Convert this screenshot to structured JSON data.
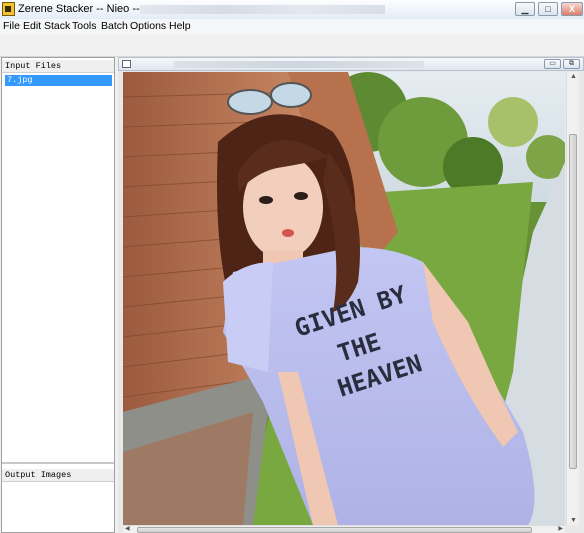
{
  "window": {
    "title": "Zerene Stacker -- Nieo --",
    "buttons": {
      "minimize": "▁",
      "maximize": "□",
      "close": "X"
    }
  },
  "menu": {
    "items": [
      "File",
      "Edit",
      "Stack",
      "Tools",
      "Batch",
      "Options",
      "Help"
    ]
  },
  "left_panel": {
    "input_header": "Input Files",
    "input_files": [
      "7.jpg"
    ],
    "output_header": "Output Images"
  },
  "image_window": {
    "buttons": {
      "minimize": "▭",
      "maximize": "⧉"
    },
    "shirt_text": [
      "GIVEN BY",
      "THE",
      "HEAVEN"
    ]
  },
  "colors": {
    "selection": "#3399ff",
    "shirt": "#b9bdee",
    "hair": "#5a2c1c",
    "wall": "#b06a4a",
    "grass": "#6f9d3e",
    "path": "#d8dfe4"
  },
  "icons": [
    "app-icon",
    "image-window-icon",
    "minimize-icon",
    "maximize-icon",
    "close-icon",
    "scroll-up-arrow-icon",
    "scroll-down-arrow-icon",
    "scroll-left-arrow-icon",
    "scroll-right-arrow-icon"
  ]
}
